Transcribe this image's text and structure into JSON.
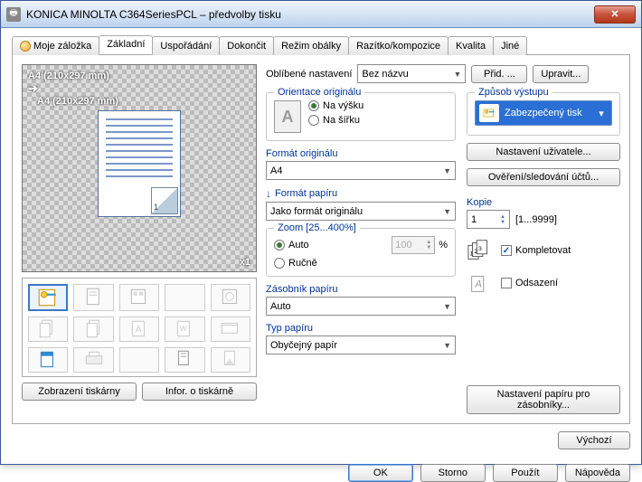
{
  "window": {
    "title": "KONICA MINOLTA C364SeriesPCL – předvolby tisku"
  },
  "tabs": [
    {
      "label": "Moje záložka"
    },
    {
      "label": "Základní"
    },
    {
      "label": "Uspořádání"
    },
    {
      "label": "Dokončit"
    },
    {
      "label": "Režim obálky"
    },
    {
      "label": "Razítko/kompozice"
    },
    {
      "label": "Kvalita"
    },
    {
      "label": "Jiné"
    }
  ],
  "preview": {
    "size_from": "A4 (210x297 mm)",
    "size_to": "A4 (210x297 mm)",
    "page_num": "1",
    "copies_badge": "x1"
  },
  "left_buttons": {
    "printer_view": "Zobrazení tiskárny",
    "printer_info": "Infor. o tiskárně"
  },
  "favorites": {
    "label": "Oblíbené nastavení",
    "value": "Bez názvu",
    "add": "Přid. ...",
    "edit": "Upravit..."
  },
  "orientation": {
    "legend": "Orientace originálu",
    "portrait": "Na výšku",
    "landscape": "Na šířku"
  },
  "original_format": {
    "label": "Formát originálu",
    "value": "A4"
  },
  "paper_format": {
    "label": "Formát papíru",
    "value": "Jako formát originálu"
  },
  "zoom": {
    "legend": "Zoom [25...400%]",
    "auto": "Auto",
    "manual": "Ručně",
    "value": "100",
    "pct": "%"
  },
  "paper_tray": {
    "label": "Zásobník papíru",
    "value": "Auto"
  },
  "paper_type": {
    "label": "Typ papíru",
    "value": "Obyčejný papír"
  },
  "output": {
    "legend": "Způsob výstupu",
    "value": "Zabezpečený tisk",
    "user_settings": "Nastavení uživatele...",
    "auth_tracking": "Ověření/sledování účtů..."
  },
  "copies": {
    "label": "Kopie",
    "value": "1",
    "range": "[1...9999]",
    "collate": "Kompletovat",
    "offset": "Odsazení"
  },
  "tray_settings_btn": "Nastavení papíru pro zásobníky...",
  "default_btn": "Výchozí",
  "footer": {
    "ok": "OK",
    "cancel": "Storno",
    "apply": "Použít",
    "help": "Nápověda"
  }
}
